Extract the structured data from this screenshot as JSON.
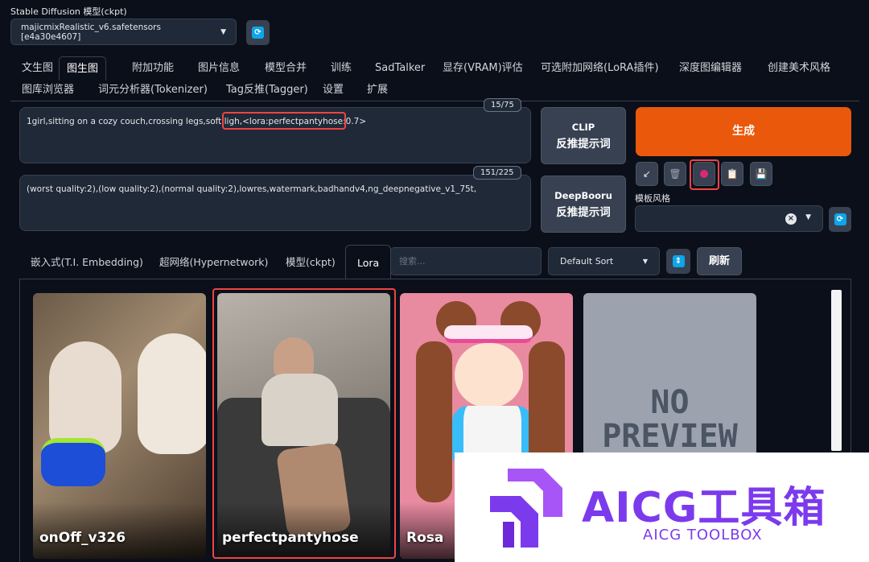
{
  "model": {
    "label": "Stable Diffusion 模型(ckpt)",
    "selected": "majicmixRealistic_v6.safetensors [e4a30e4607]"
  },
  "tabs": {
    "row1": [
      "文生图",
      "图生图",
      "附加功能",
      "图片信息",
      "模型合并",
      "训练",
      "SadTalker",
      "显存(VRAM)评估",
      "可选附加网络(LoRA插件)",
      "深度图编辑器",
      "创建美术风格"
    ],
    "row2": [
      "图库浏览器",
      "词元分析器(Tokenizer)",
      "Tag反推(Tagger)",
      "设置",
      "扩展"
    ],
    "active": "图生图"
  },
  "prompt": {
    "positive_main": "1girl,sitting on a cozy couch,crossing legs,soft ligh",
    "positive_lora": ",<lora:perfectpantyhose:0.7>",
    "positive_count": "15/75",
    "negative": "(worst quality:2),(low quality:2),(normal quality:2),lowres,watermark,badhandv4,ng_deepnegative_v1_75t,",
    "negative_count": "151/225"
  },
  "buttons": {
    "clip_line1": "CLIP",
    "clip_line2": "反推提示词",
    "deepbooru_line1": "DeepBooru",
    "deepbooru_line2": "反推提示词",
    "generate": "生成",
    "refresh": "刷新"
  },
  "toolbar_icons": [
    "arrow-down-left-icon",
    "trash-icon",
    "extra-networks-icon",
    "clipboard-icon",
    "save-icon"
  ],
  "style": {
    "label": "模板风格",
    "value": ""
  },
  "extra_tabs": {
    "items": [
      "嵌入式(T.I. Embedding)",
      "超网络(Hypernetwork)",
      "模型(ckpt)",
      "Lora"
    ],
    "active": "Lora",
    "search_placeholder": "搜索...",
    "sort": "Default Sort"
  },
  "cards": [
    {
      "name": "onOff_v326"
    },
    {
      "name": "perfectpantyhose"
    },
    {
      "name": "Rosa"
    },
    {
      "name": ""
    }
  ],
  "no_preview": [
    "NO",
    "PREVIEW"
  ],
  "watermark": {
    "title": "AICG工具箱",
    "subtitle": "AICG TOOLBOX"
  },
  "colors": {
    "accent_orange": "#ea580c",
    "highlight_red": "#ef4444",
    "brand_purple": "#7c3aed",
    "icon_blue": "#0ea5e9"
  }
}
